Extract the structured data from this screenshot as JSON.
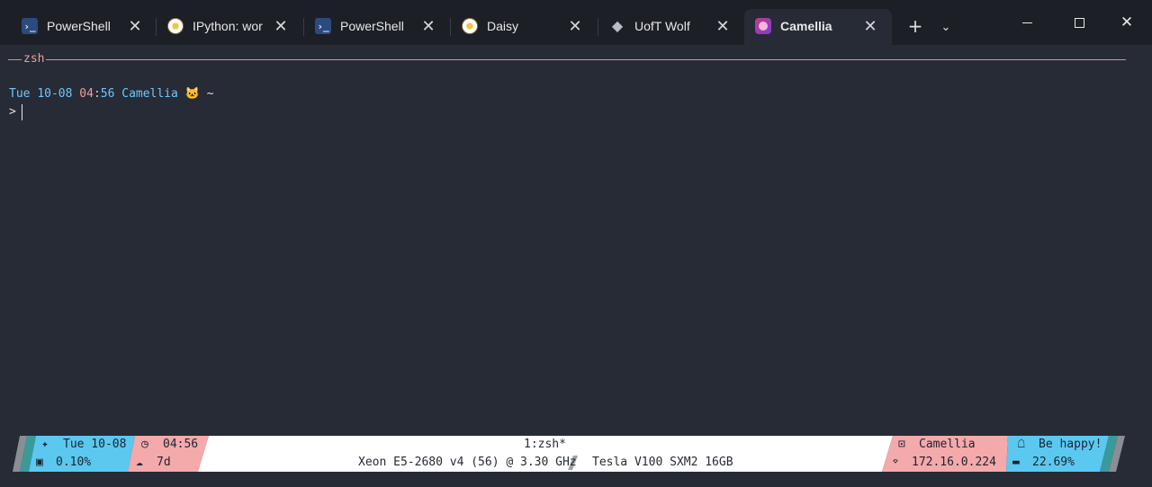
{
  "tabs": [
    {
      "label": "PowerShell",
      "icon": "powershell-icon",
      "active": false
    },
    {
      "label": "IPython: wor",
      "icon": "ipython-icon",
      "active": false
    },
    {
      "label": "PowerShell",
      "icon": "powershell-icon",
      "active": false
    },
    {
      "label": "Daisy",
      "icon": "daisy-icon",
      "active": false
    },
    {
      "label": "UofT Wolf",
      "icon": "wolf-icon",
      "active": false
    },
    {
      "label": "Camellia",
      "icon": "camellia-icon",
      "active": true
    }
  ],
  "tab_controls": {
    "new_tab": "+",
    "dropdown": "⌄"
  },
  "window_controls": {
    "close": "✕"
  },
  "terminal": {
    "pane_title": "zsh",
    "prompt": {
      "day": "Tue",
      "date": "10-08",
      "hour": "04",
      "colon": ":",
      "minute": "56",
      "host": "Camellia",
      "emoji": "🐱",
      "dir": "~"
    },
    "cursor_prompt": ">"
  },
  "statusbar": {
    "date": "Tue 10-08",
    "cpu_usage": "0.10%",
    "time": "04:56",
    "uptime": "7d",
    "window": "1:zsh*",
    "cpu_model": "Xeon E5-2680 v4 (56) @ 3.30 GHz",
    "gpu_model": "Tesla V100 SXM2 16GB",
    "hostname": "Camellia",
    "ip": "172.16.0.224",
    "message": "Be happy!",
    "mem_usage": "22.69%",
    "icons": {
      "date": "✦",
      "cpu": "▣",
      "time": "◷",
      "uptime": "☁",
      "terminal": "⊡",
      "wifi": "⌔",
      "chat": "☖",
      "memory": "▬"
    },
    "colors": {
      "cyan": "#5bc8f0",
      "pink": "#f4a9ab",
      "white": "#ffffff",
      "teal": "#3a9a9a",
      "grey": "#8b8e94"
    }
  }
}
